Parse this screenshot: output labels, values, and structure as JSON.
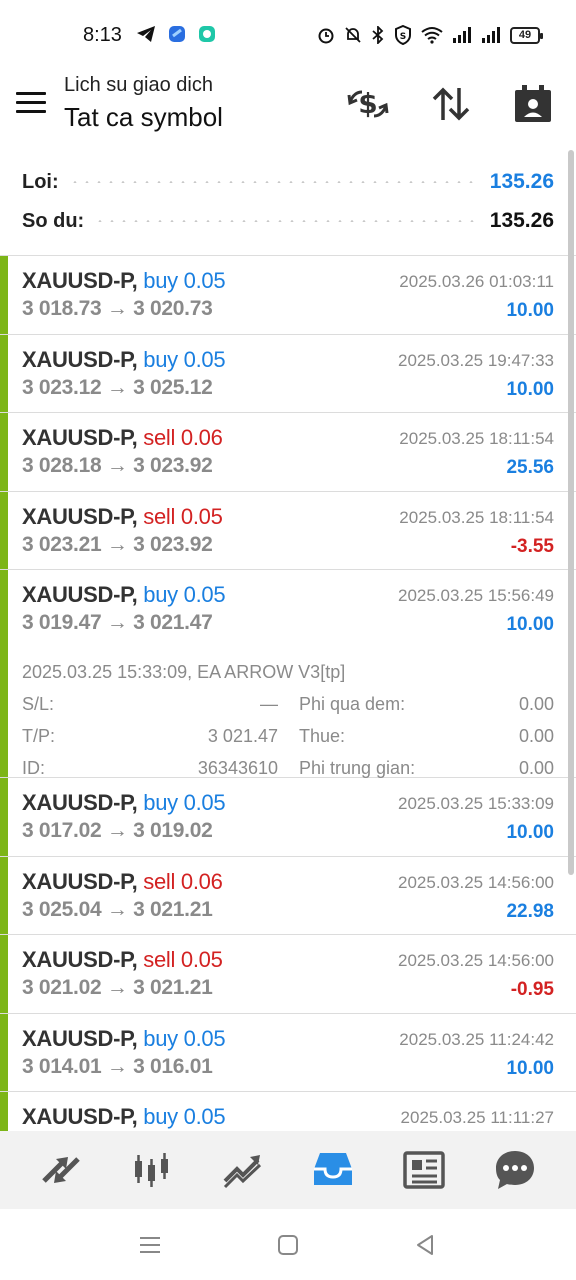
{
  "status_bar": {
    "time": "8:13",
    "battery": "49",
    "left_icons": [
      "telegram-icon",
      "app-icon",
      "messenger-icon"
    ],
    "right_icons": [
      "alarm-icon",
      "mute-icon",
      "bluetooth-icon",
      "vpn-icon",
      "wifi-icon",
      "signal-icon",
      "signal-icon"
    ]
  },
  "header": {
    "subtitle": "Lich su giao dich",
    "title": "Tat ca symbol",
    "actions": [
      "currency-swap-icon",
      "sort-icon",
      "calendar-icon"
    ]
  },
  "summary": {
    "profit_label": "Loi:",
    "profit_value": "135.26",
    "balance_label": "So du:",
    "balance_value": "135.26"
  },
  "trades": [
    {
      "symbol": "XAUUSD-P,",
      "side": "buy 0.05",
      "type": "buy",
      "prices": "3 018.73 → 3 020.73",
      "time": "2025.03.26 01:03:11",
      "profit": "10.00",
      "positive": true
    },
    {
      "symbol": "XAUUSD-P,",
      "side": "buy 0.05",
      "type": "buy",
      "prices": "3 023.12 → 3 025.12",
      "time": "2025.03.25 19:47:33",
      "profit": "10.00",
      "positive": true
    },
    {
      "symbol": "XAUUSD-P,",
      "side": "sell 0.06",
      "type": "sell",
      "prices": "3 028.18 → 3 023.92",
      "time": "2025.03.25 18:11:54",
      "profit": "25.56",
      "positive": true
    },
    {
      "symbol": "XAUUSD-P,",
      "side": "sell 0.05",
      "type": "sell",
      "prices": "3 023.21 → 3 023.92",
      "time": "2025.03.25 18:11:54",
      "profit": "-3.55",
      "positive": false
    },
    {
      "symbol": "XAUUSD-P,",
      "side": "buy 0.05",
      "type": "buy",
      "prices": "3 019.47 → 3 021.47",
      "time": "2025.03.25 15:56:49",
      "profit": "10.00",
      "positive": true
    },
    {
      "symbol": "XAUUSD-P,",
      "side": "buy 0.05",
      "type": "buy",
      "prices": "3 017.02 → 3 019.02",
      "time": "2025.03.25 15:33:09",
      "profit": "10.00",
      "positive": true
    },
    {
      "symbol": "XAUUSD-P,",
      "side": "sell 0.06",
      "type": "sell",
      "prices": "3 025.04 → 3 021.21",
      "time": "2025.03.25 14:56:00",
      "profit": "22.98",
      "positive": true
    },
    {
      "symbol": "XAUUSD-P,",
      "side": "sell 0.05",
      "type": "sell",
      "prices": "3 021.02 → 3 021.21",
      "time": "2025.03.25 14:56:00",
      "profit": "-0.95",
      "positive": false
    },
    {
      "symbol": "XAUUSD-P,",
      "side": "buy 0.05",
      "type": "buy",
      "prices": "3 014.01 → 3 016.01",
      "time": "2025.03.25 11:24:42",
      "profit": "10.00",
      "positive": true
    },
    {
      "symbol": "XAUUSD-P,",
      "side": "buy 0.05",
      "type": "buy",
      "prices": "",
      "time": "2025.03.25 11:11:27",
      "profit": "",
      "positive": true
    }
  ],
  "expanded_detail": {
    "line": "2025.03.25 15:33:09, EA ARROW V3[tp]",
    "sl_label": "S/L:",
    "sl_value": "—",
    "tp_label": "T/P:",
    "tp_value": "3 021.47",
    "id_label": "ID:",
    "id_value": "36343610",
    "swap_label": "Phi qua dem:",
    "swap_value": "0.00",
    "tax_label": "Thue:",
    "tax_value": "0.00",
    "commission_label": "Phi trung gian:",
    "commission_value": "0.00"
  },
  "bottom_nav": [
    "quotes-icon",
    "chart-icon",
    "trade-icon",
    "history-icon",
    "news-icon",
    "chat-icon"
  ],
  "colors": {
    "accent": "#1a7fe0",
    "loss": "#d32222",
    "bar": "#7cb518",
    "nav_active": "#2a8ee6"
  }
}
